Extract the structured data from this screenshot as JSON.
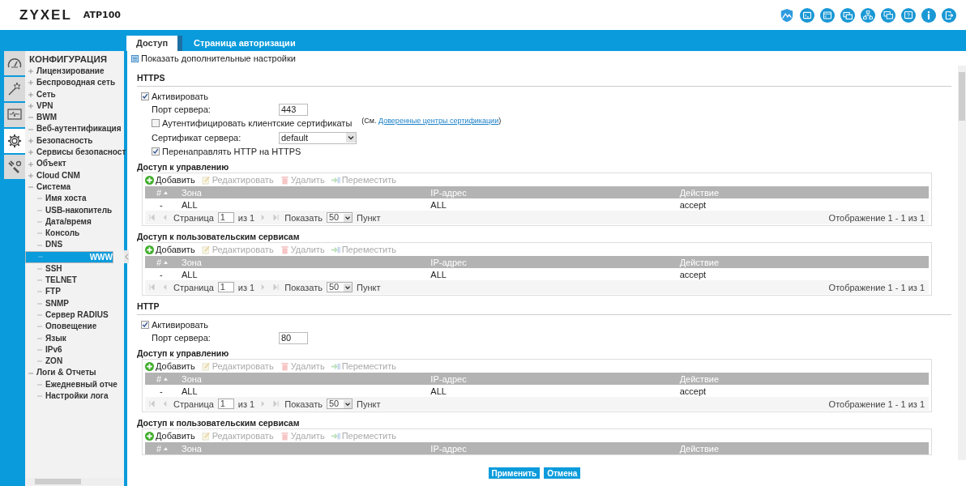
{
  "header": {
    "logo": "ZYXEL",
    "model": "ATP100"
  },
  "tabs": [
    {
      "label": "Доступ",
      "selected": true
    },
    {
      "label": "Страница авторизации",
      "selected": false
    }
  ],
  "nav_rail": [
    {
      "kind": "dashboard",
      "selected": false
    },
    {
      "kind": "wizard",
      "selected": false
    },
    {
      "kind": "monitor",
      "selected": false
    },
    {
      "kind": "configuration",
      "selected": true
    },
    {
      "kind": "maintenance",
      "selected": false
    }
  ],
  "sidebar": {
    "title": "КОНФИГУРАЦИЯ",
    "items": [
      {
        "label": "Лицензирование",
        "expanded": false,
        "selected": false
      },
      {
        "label": "Беспроводная сеть",
        "expanded": false,
        "selected": false
      },
      {
        "label": "Сеть",
        "expanded": false,
        "selected": false
      },
      {
        "label": "VPN",
        "expanded": false,
        "selected": false
      },
      {
        "label": "BWM",
        "expanded": true,
        "selected": false
      },
      {
        "label": "Веб-аутентификация",
        "expanded": true,
        "selected": false
      },
      {
        "label": "Безопасность",
        "expanded": false,
        "selected": false
      },
      {
        "label": "Сервисы безопасност",
        "expanded": false,
        "selected": false
      },
      {
        "label": "Объект",
        "expanded": false,
        "selected": false
      },
      {
        "label": "Cloud CNM",
        "expanded": false,
        "selected": false
      },
      {
        "label": "Система",
        "expanded": true,
        "selected": false,
        "children": [
          {
            "label": "Имя хоста",
            "selected": false
          },
          {
            "label": "USB-накопитель",
            "selected": false
          },
          {
            "label": "Дата/время",
            "selected": false
          },
          {
            "label": "Консоль",
            "selected": false
          },
          {
            "label": "DNS",
            "selected": false
          },
          {
            "label": "WWW",
            "selected": true
          },
          {
            "label": "SSH",
            "selected": false
          },
          {
            "label": "TELNET",
            "selected": false
          },
          {
            "label": "FTP",
            "selected": false
          },
          {
            "label": "SNMP",
            "selected": false
          },
          {
            "label": "Сервер RADIUS",
            "selected": false
          },
          {
            "label": "Оповещение",
            "selected": false
          },
          {
            "label": "Язык",
            "selected": false
          },
          {
            "label": "IPv6",
            "selected": false
          },
          {
            "label": "ZON",
            "selected": false
          }
        ]
      },
      {
        "label": "Логи & Отчеты",
        "expanded": true,
        "selected": false,
        "children": [
          {
            "label": "Ежедневный отче",
            "selected": false
          },
          {
            "label": "Настройки лога",
            "selected": false
          }
        ]
      }
    ]
  },
  "toolbar": {
    "label": "Показать дополнительные настройки"
  },
  "sections": [
    {
      "title": "HTTPS",
      "enable": {
        "label": "Активировать",
        "checked": true
      },
      "fields": [
        {
          "kind": "input",
          "label": "Порт сервера:",
          "value": "443"
        },
        {
          "kind": "checkbox",
          "label": "Аутентифицировать клиентские сертификаты",
          "checked": false,
          "note_prefix": "(См. ",
          "note_link": "Доверенные центры сертификации",
          "note_suffix": ")"
        },
        {
          "kind": "select",
          "label": "Сертификат сервера:",
          "value": "default"
        },
        {
          "kind": "checkbox",
          "label": "Перенаправлять HTTP на HTTPS",
          "checked": true
        }
      ],
      "tables": [
        {
          "title": "Доступ к управлению",
          "actions": [
            {
              "kind": "add",
              "label": "Добавить",
              "disabled": false
            },
            {
              "kind": "edit",
              "label": "Редактировать",
              "disabled": true
            },
            {
              "kind": "delete",
              "label": "Удалить",
              "disabled": true
            },
            {
              "kind": "move",
              "label": "Переместить",
              "disabled": true
            }
          ],
          "columns": [
            {
              "label": "#",
              "sorted": true
            },
            {
              "label": "Зона",
              "sorted": false
            },
            {
              "label": "IP-адрес",
              "sorted": false
            },
            {
              "label": "Действие",
              "sorted": false
            }
          ],
          "rows": [
            [
              "-",
              "ALL",
              "ALL",
              "accept"
            ]
          ],
          "pager": {
            "page_label": "Страница",
            "page": "1",
            "of": "из 1",
            "show_label": "Показать",
            "per_page": "50",
            "unit": "Пункт",
            "summary": "Отображение 1 - 1 из 1"
          }
        },
        {
          "title": "Доступ к пользовательским сервисам",
          "actions": [
            {
              "kind": "add",
              "label": "Добавить",
              "disabled": false
            },
            {
              "kind": "edit",
              "label": "Редактировать",
              "disabled": true
            },
            {
              "kind": "delete",
              "label": "Удалить",
              "disabled": true
            },
            {
              "kind": "move",
              "label": "Переместить",
              "disabled": true
            }
          ],
          "columns": [
            {
              "label": "#",
              "sorted": true
            },
            {
              "label": "Зона",
              "sorted": false
            },
            {
              "label": "IP-адрес",
              "sorted": false
            },
            {
              "label": "Действие",
              "sorted": false
            }
          ],
          "rows": [
            [
              "-",
              "ALL",
              "ALL",
              "accept"
            ]
          ],
          "pager": {
            "page_label": "Страница",
            "page": "1",
            "of": "из 1",
            "show_label": "Показать",
            "per_page": "50",
            "unit": "Пункт",
            "summary": "Отображение 1 - 1 из 1"
          }
        }
      ]
    },
    {
      "title": "HTTP",
      "enable": {
        "label": "Активировать",
        "checked": true
      },
      "fields": [
        {
          "kind": "input",
          "label": "Порт сервера:",
          "value": "80"
        }
      ],
      "tables": [
        {
          "title": "Доступ к управлению",
          "actions": [
            {
              "kind": "add",
              "label": "Добавить",
              "disabled": false
            },
            {
              "kind": "edit",
              "label": "Редактировать",
              "disabled": true
            },
            {
              "kind": "delete",
              "label": "Удалить",
              "disabled": true
            },
            {
              "kind": "move",
              "label": "Переместить",
              "disabled": true
            }
          ],
          "columns": [
            {
              "label": "#",
              "sorted": true
            },
            {
              "label": "Зона",
              "sorted": false
            },
            {
              "label": "IP-адрес",
              "sorted": false
            },
            {
              "label": "Действие",
              "sorted": false
            }
          ],
          "rows": [
            [
              "-",
              "ALL",
              "ALL",
              "accept"
            ]
          ],
          "pager": {
            "page_label": "Страница",
            "page": "1",
            "of": "из 1",
            "show_label": "Показать",
            "per_page": "50",
            "unit": "Пункт",
            "summary": "Отображение 1 - 1 из 1"
          }
        },
        {
          "title": "Доступ к пользовательским сервисам",
          "actions": [
            {
              "kind": "add",
              "label": "Добавить",
              "disabled": false
            },
            {
              "kind": "edit",
              "label": "Редактировать",
              "disabled": true
            },
            {
              "kind": "delete",
              "label": "Удалить",
              "disabled": true
            },
            {
              "kind": "move",
              "label": "Переместить",
              "disabled": true
            }
          ],
          "columns": [
            {
              "label": "#",
              "sorted": true
            },
            {
              "label": "Зона",
              "sorted": false
            },
            {
              "label": "IP-адрес",
              "sorted": false
            },
            {
              "label": "Действие",
              "sorted": false
            }
          ]
        }
      ]
    }
  ],
  "buttons": [
    {
      "label": "Применить"
    },
    {
      "label": "Отмена"
    }
  ]
}
